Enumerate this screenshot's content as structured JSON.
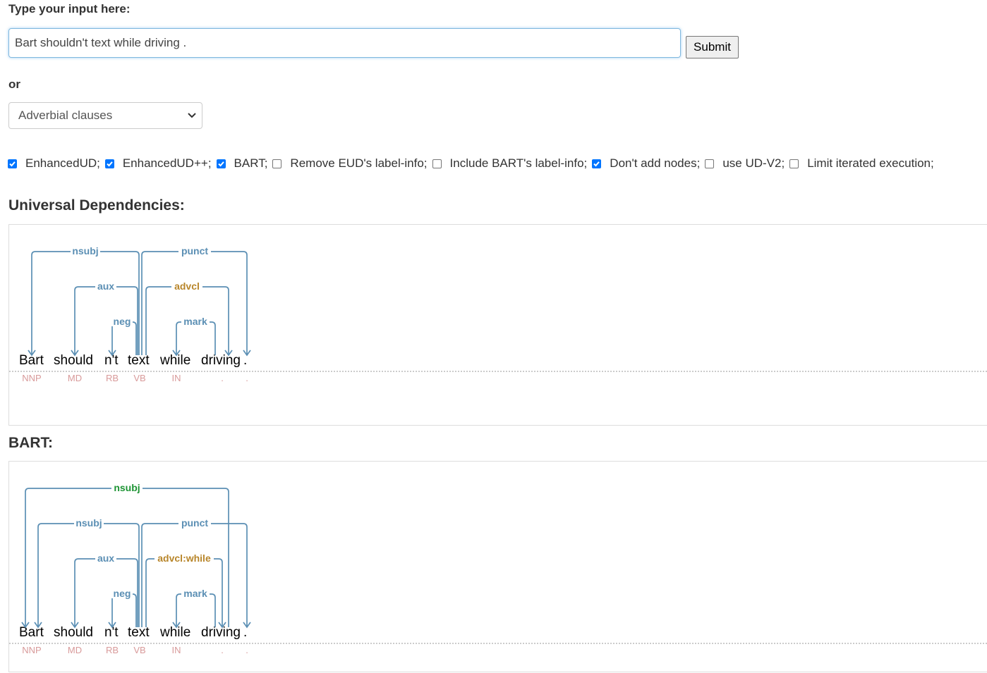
{
  "input_section": {
    "label": "Type your input here:",
    "input_value": "Bart shouldn't text while driving .",
    "submit_label": "Submit"
  },
  "or_label": "or",
  "example_select": {
    "selected": "Adverbial clauses"
  },
  "options": [
    {
      "label": "EnhancedUD;",
      "checked": true
    },
    {
      "label": "EnhancedUD++;",
      "checked": true
    },
    {
      "label": "BART;",
      "checked": true
    },
    {
      "label": "Remove EUD's label-info;",
      "checked": false
    },
    {
      "label": "Include BART's label-info;",
      "checked": false
    },
    {
      "label": "Don't add nodes;",
      "checked": true
    },
    {
      "label": "use UD-V2;",
      "checked": false
    },
    {
      "label": "Limit iterated execution;",
      "checked": false
    }
  ],
  "colors": {
    "edge": "#5b8fb4",
    "label_default": "#5b8fb4",
    "label_advcl": "#b8862b",
    "label_bart_new": "#1d9434",
    "pos": "#d89a9a",
    "word": "#000000"
  },
  "ud_section": {
    "title": "Universal Dependencies:",
    "tokens": [
      {
        "word": "Bart",
        "pos": "NNP"
      },
      {
        "word": "should",
        "pos": "MD"
      },
      {
        "word": "n't",
        "pos": "RB"
      },
      {
        "word": "text",
        "pos": "VB"
      },
      {
        "word": "while",
        "pos": "IN"
      },
      {
        "word": "driving",
        "pos": "."
      },
      {
        "word": ".",
        "pos": "."
      }
    ],
    "arcs": [
      {
        "label": "nsubj",
        "head": 3,
        "dep": 0,
        "color": "default"
      },
      {
        "label": "aux",
        "head": 3,
        "dep": 1,
        "color": "default"
      },
      {
        "label": "neg",
        "head": 3,
        "dep": 2,
        "color": "default"
      },
      {
        "label": "punct",
        "head": 3,
        "dep": 6,
        "color": "default"
      },
      {
        "label": "advcl",
        "head": 3,
        "dep": 5,
        "color": "advcl"
      },
      {
        "label": "mark",
        "head": 5,
        "dep": 4,
        "color": "default"
      }
    ]
  },
  "bart_section": {
    "title": "BART:",
    "tokens": [
      {
        "word": "Bart",
        "pos": "NNP"
      },
      {
        "word": "should",
        "pos": "MD"
      },
      {
        "word": "n't",
        "pos": "RB"
      },
      {
        "word": "text",
        "pos": "VB"
      },
      {
        "word": "while",
        "pos": "IN"
      },
      {
        "word": "driving",
        "pos": "."
      },
      {
        "word": ".",
        "pos": "."
      }
    ],
    "arcs": [
      {
        "label": "nsubj",
        "head": 5,
        "dep": 0,
        "color": "bart_new"
      },
      {
        "label": "nsubj",
        "head": 3,
        "dep": 0,
        "color": "default"
      },
      {
        "label": "aux",
        "head": 3,
        "dep": 1,
        "color": "default"
      },
      {
        "label": "neg",
        "head": 3,
        "dep": 2,
        "color": "default"
      },
      {
        "label": "punct",
        "head": 3,
        "dep": 6,
        "color": "default"
      },
      {
        "label": "advcl:while",
        "head": 3,
        "dep": 5,
        "color": "advcl"
      },
      {
        "label": "mark",
        "head": 5,
        "dep": 4,
        "color": "default"
      }
    ]
  }
}
